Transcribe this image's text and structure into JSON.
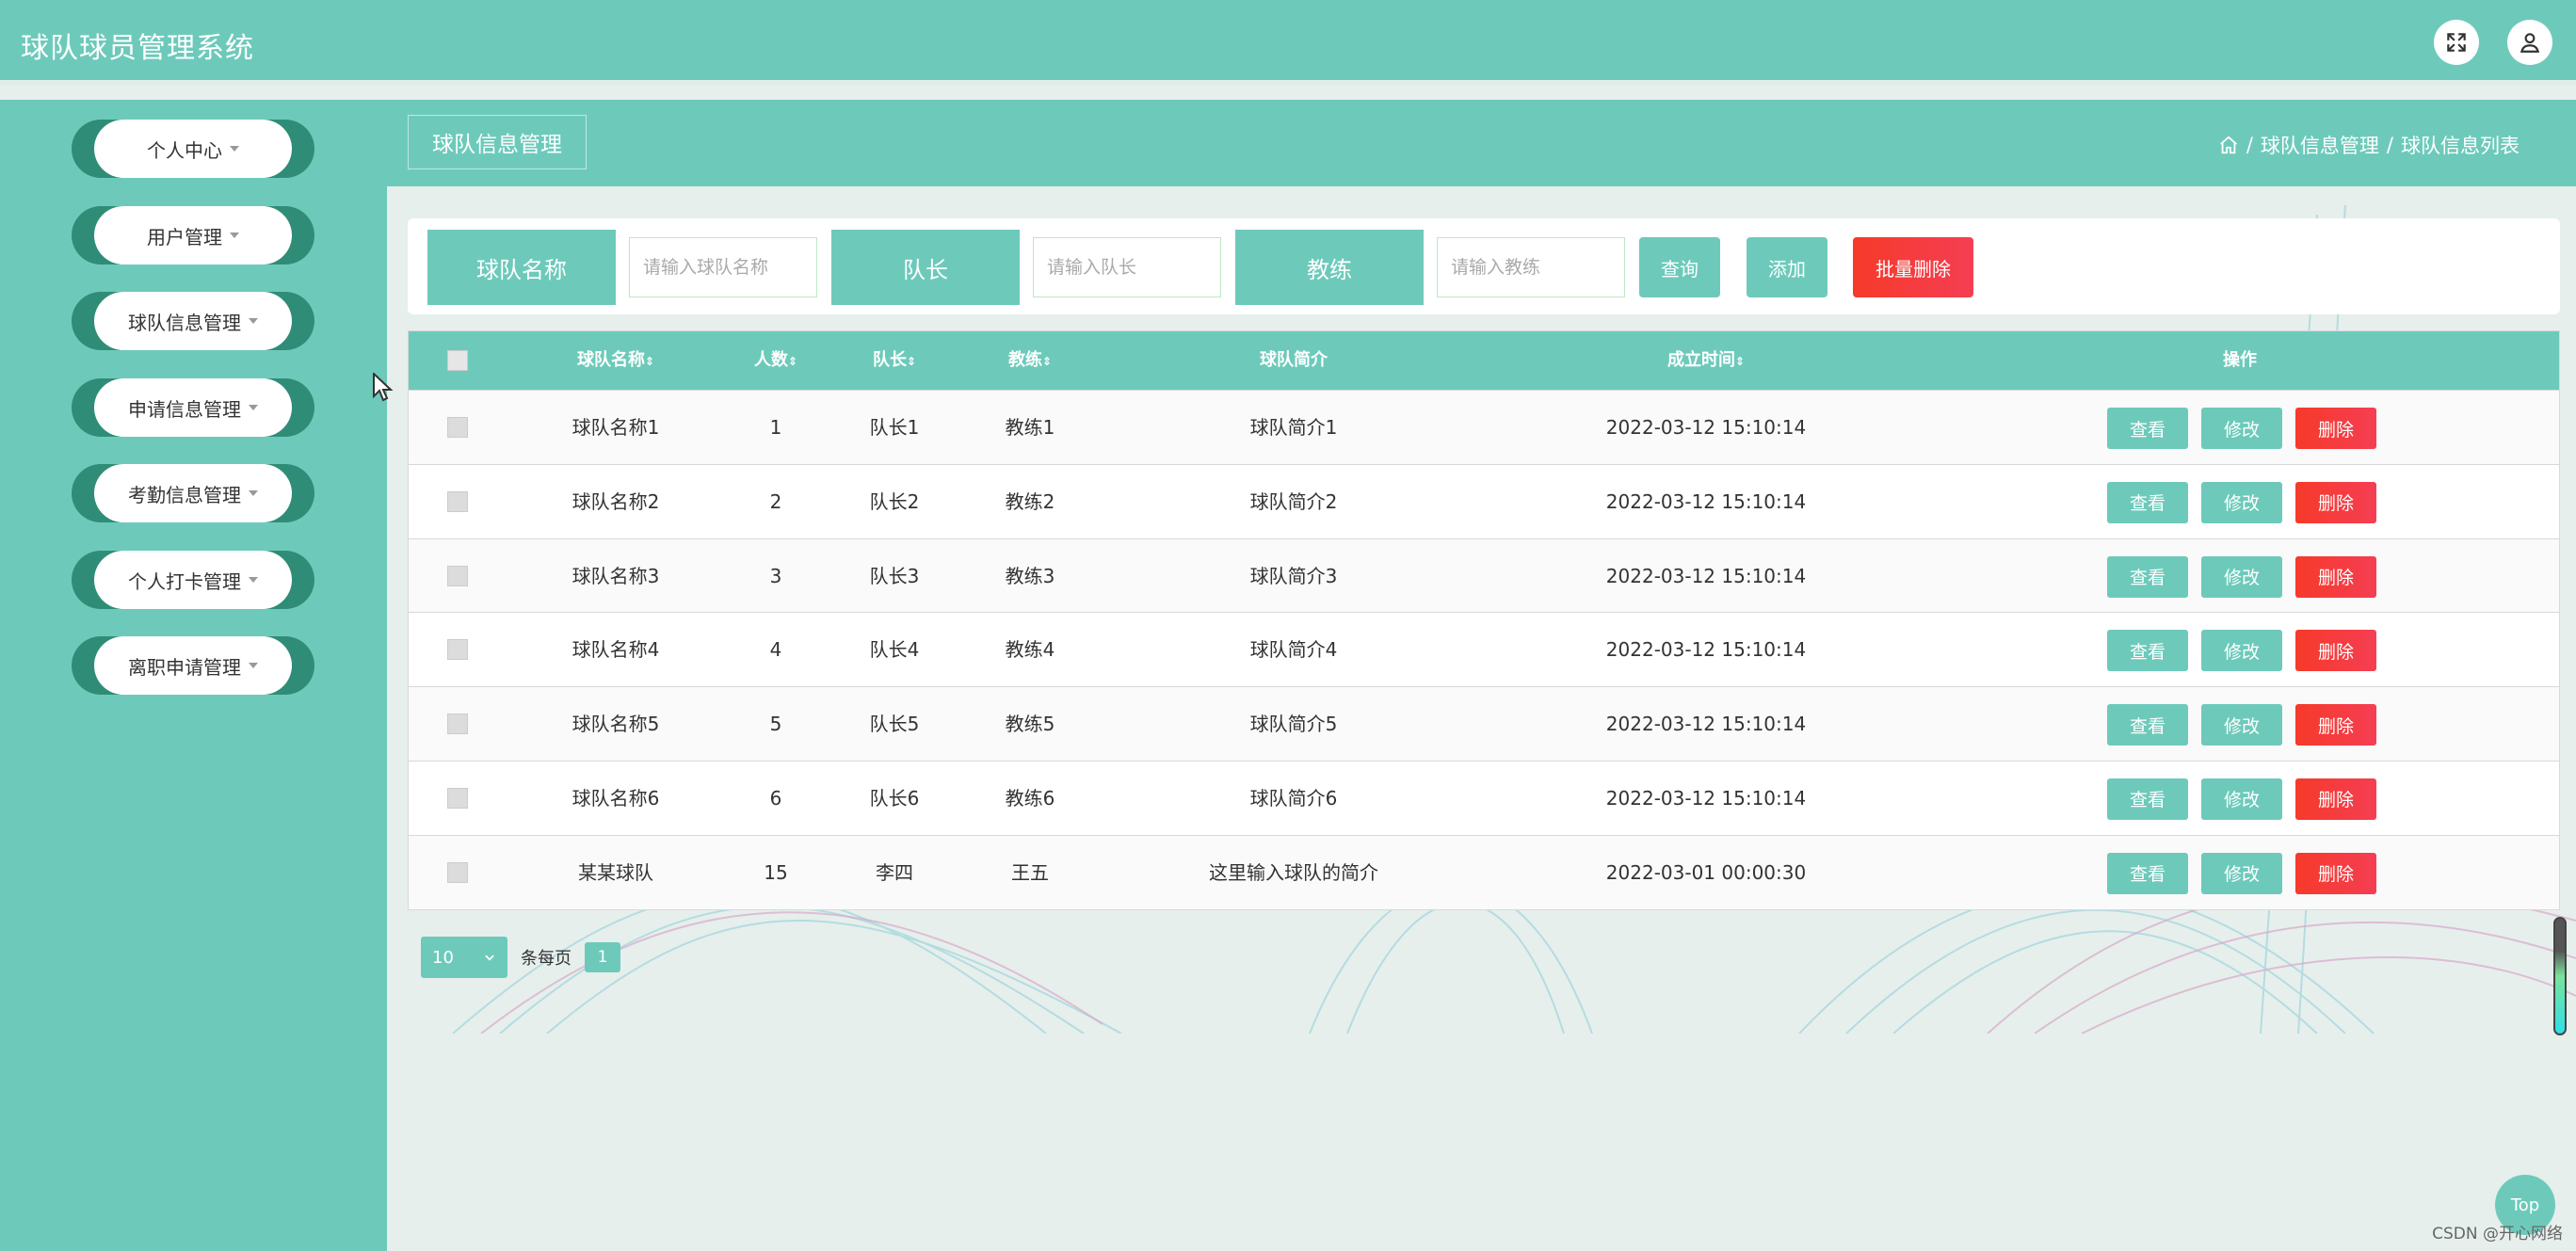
{
  "app": {
    "title": "球队球员管理系统"
  },
  "header": {
    "fullscreen_icon": "fullscreen-icon",
    "user_icon": "user-icon"
  },
  "sidebar": {
    "items": [
      {
        "label": "个人中心"
      },
      {
        "label": "用户管理"
      },
      {
        "label": "球队信息管理"
      },
      {
        "label": "申请信息管理"
      },
      {
        "label": "考勤信息管理"
      },
      {
        "label": "个人打卡管理"
      },
      {
        "label": "离职申请管理"
      }
    ]
  },
  "breadcrumb": {
    "page_title": "球队信息管理",
    "sep1": "/",
    "level1": "球队信息管理",
    "sep2": "/",
    "level2": "球队信息列表"
  },
  "search": {
    "name_label": "球队名称",
    "name_placeholder": "请输入球队名称",
    "captain_label": "队长",
    "captain_placeholder": "请输入队长",
    "coach_label": "教练",
    "coach_placeholder": "请输入教练",
    "query_button": "查询",
    "add_button": "添加",
    "batch_delete_button": "批量删除"
  },
  "table": {
    "columns": [
      "球队名称",
      "人数",
      "队长",
      "教练",
      "球队简介",
      "成立时间",
      "操作"
    ],
    "sort_mark": "⇕",
    "rows": [
      {
        "name": "球队名称1",
        "count": "1",
        "captain": "队长1",
        "coach": "教练1",
        "intro": "球队简介1",
        "founded": "2022-03-12 15:10:14"
      },
      {
        "name": "球队名称2",
        "count": "2",
        "captain": "队长2",
        "coach": "教练2",
        "intro": "球队简介2",
        "founded": "2022-03-12 15:10:14"
      },
      {
        "name": "球队名称3",
        "count": "3",
        "captain": "队长3",
        "coach": "教练3",
        "intro": "球队简介3",
        "founded": "2022-03-12 15:10:14"
      },
      {
        "name": "球队名称4",
        "count": "4",
        "captain": "队长4",
        "coach": "教练4",
        "intro": "球队简介4",
        "founded": "2022-03-12 15:10:14"
      },
      {
        "name": "球队名称5",
        "count": "5",
        "captain": "队长5",
        "coach": "教练5",
        "intro": "球队简介5",
        "founded": "2022-03-12 15:10:14"
      },
      {
        "name": "球队名称6",
        "count": "6",
        "captain": "队长6",
        "coach": "教练6",
        "intro": "球队简介6",
        "founded": "2022-03-12 15:10:14"
      },
      {
        "name": "某某球队",
        "count": "15",
        "captain": "李四",
        "coach": "王五",
        "intro": "这里输入球队的简介",
        "founded": "2022-03-01 00:00:30"
      }
    ],
    "actions": {
      "view": "查看",
      "edit": "修改",
      "delete": "删除"
    }
  },
  "pagination": {
    "page_size": "10",
    "per_page_text": "条每页",
    "current_page": "1"
  },
  "back_to_top": "Top",
  "watermark": "CSDN @开心网络",
  "colors": {
    "primary": "#6dcabb",
    "danger": "#f53e3e",
    "sidebar_accent": "#2f8d77"
  }
}
